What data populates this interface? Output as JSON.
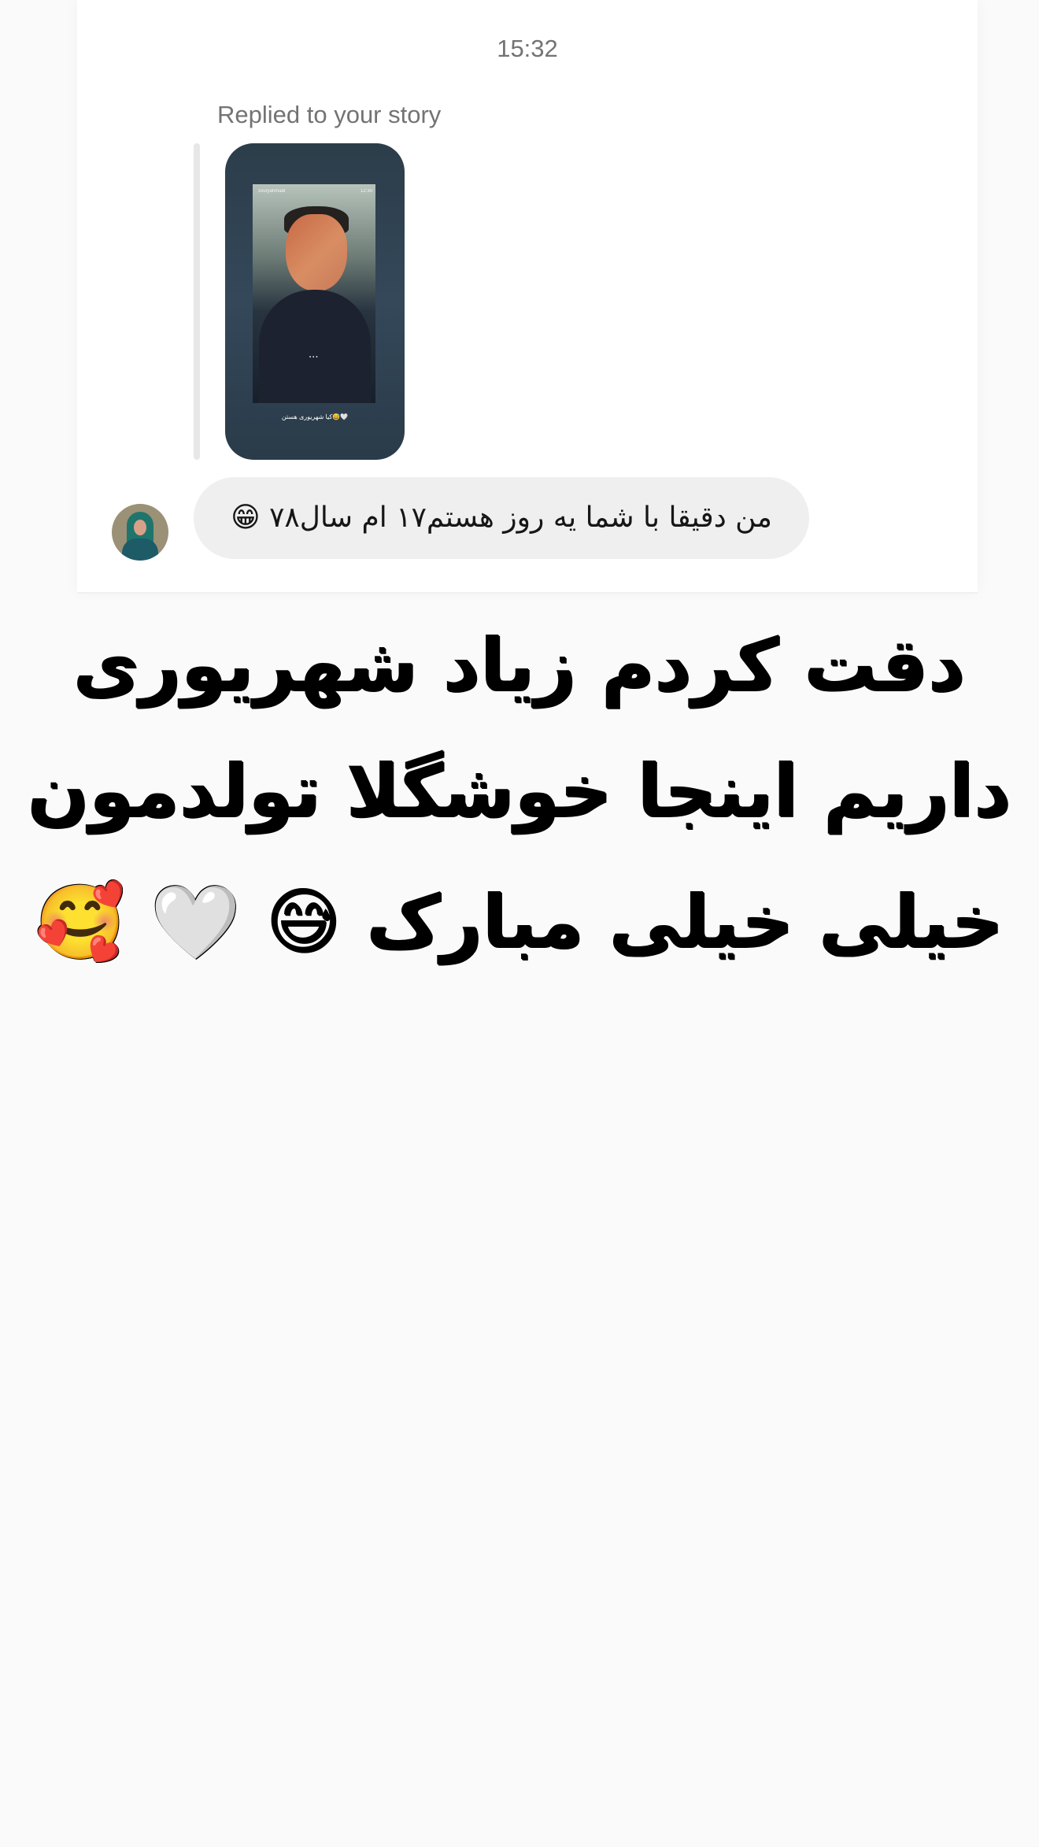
{
  "chat": {
    "timestamp": "15:32",
    "reply_label": "Replied to your story",
    "message": "من دقیقا با شما یه روز هستم۱۷ ام سال۷۸ 😁"
  },
  "story": {
    "username": "zouryahmadi",
    "time": "12:30",
    "dots": "...",
    "caption": "کیا شهریوری هستن😅🤍"
  },
  "overlay": {
    "line_1": "دقت کردم زیاد شهریوری",
    "line_2": "داریم اینجا خوشگلا تولدمون",
    "line_3": "خیلی خیلی مبارک 😅 🤍 🥰"
  }
}
